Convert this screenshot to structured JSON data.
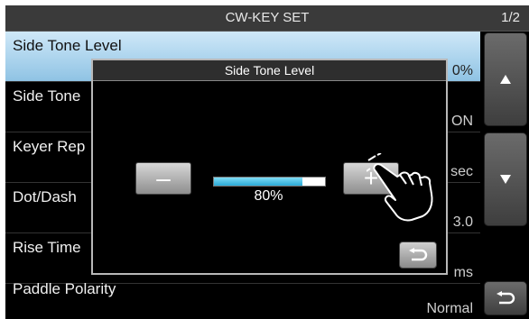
{
  "header": {
    "title": "CW-KEY SET",
    "page": "1/2"
  },
  "menu": {
    "items": [
      {
        "label": "Side Tone Level",
        "value": "0%"
      },
      {
        "label": "Side Tone",
        "value": "ON"
      },
      {
        "label": "Keyer Rep",
        "value": "sec"
      },
      {
        "label": "Dot/Dash",
        "value": "3.0"
      },
      {
        "label": "Rise Time",
        "value": "ms"
      },
      {
        "label": "Paddle Polarity",
        "value": "Normal"
      }
    ]
  },
  "side_buttons": {
    "up_icon": "up-triangle-icon",
    "down_icon": "down-triangle-icon",
    "back_icon": "return-arrow-icon"
  },
  "dialog": {
    "title": "Side Tone Level",
    "minus_label": "–",
    "plus_label": "+",
    "level_text": "80%",
    "level_fraction": 0.8
  },
  "colors": {
    "selected_row": "#a9d4ef",
    "level_bar": "#3ab8e0"
  }
}
